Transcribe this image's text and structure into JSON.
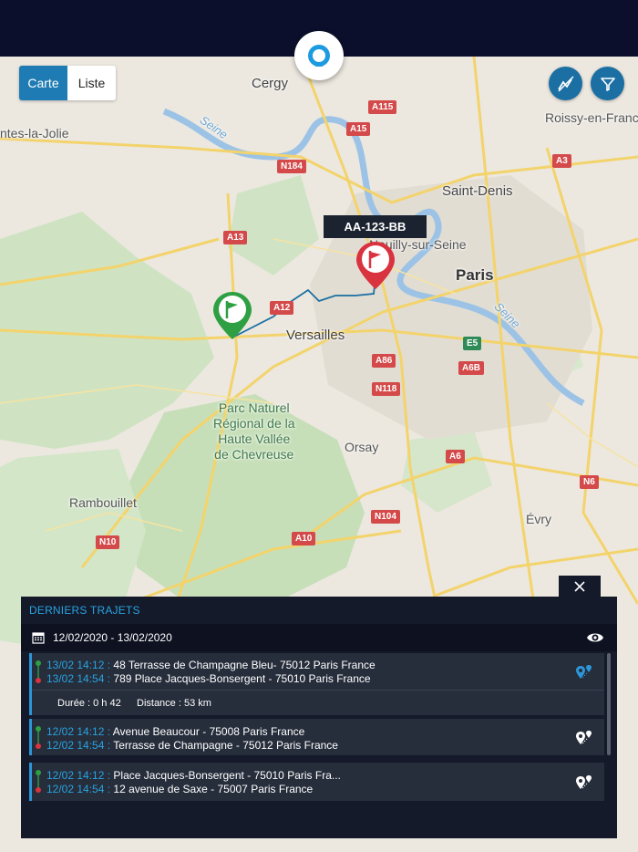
{
  "toggle": {
    "map_label": "Carte",
    "list_label": "Liste"
  },
  "vehicle": {
    "plate": "AA-123-BB"
  },
  "map": {
    "places": {
      "cergy": "Cergy",
      "mantes": "ntes-la-Jolie",
      "roissy": "Roissy-en-France",
      "saint_denis": "Saint-Denis",
      "neuilly": "Neuilly-sur-Seine",
      "paris": "Paris",
      "versailles": "Versailles",
      "orsay": "Orsay",
      "rambouillet": "Rambouillet",
      "evry": "Évry",
      "seine1": "Seine",
      "seine2": "Seine",
      "park": "Parc Naturel\nRégional de la\nHaute Vallée\nde Chevreuse"
    },
    "roads": {
      "a115": "A115",
      "a15": "A15",
      "n184": "N184",
      "a3": "A3",
      "a13": "A13",
      "a12": "A12",
      "e5": "E5",
      "a86": "A86",
      "a6b": "A6B",
      "n118": "N118",
      "a6": "A6",
      "n6": "N6",
      "n104": "N104",
      "a10": "A10",
      "n10": "N10"
    }
  },
  "panel": {
    "title": "DERNIERS TRAJETS",
    "date_range": "12/02/2020 - 13/02/2020",
    "trips": [
      {
        "start_time": "13/02 14:12 :",
        "start_addr": "48 Terrasse de Champagne Bleu- 75012 Paris France",
        "end_time": "13/02 14:54 :",
        "end_addr": "789 Place Jacques-Bonsergent  - 75010 Paris France",
        "duration": "Durée : 0 h 42",
        "distance": "Distance : 53 km"
      },
      {
        "start_time": "12/02 14:12 :",
        "start_addr": "Avenue Beaucour - 75008 Paris France",
        "end_time": "12/02 14:54 :",
        "end_addr": "Terrasse de Champagne - 75012 Paris France"
      },
      {
        "start_time": "12/02 14:12 :",
        "start_addr": "Place Jacques-Bonsergent  - 75010 Paris Fra...",
        "end_time": "12/02 14:54 :",
        "end_addr": "12 avenue de Saxe - 75007 Paris France"
      }
    ]
  },
  "colors": {
    "topbar": "#0b0f2b",
    "accent": "#1f7bb3",
    "panel": "#141a2a",
    "start_flag": "#2ea043",
    "end_flag": "#d9333f"
  }
}
